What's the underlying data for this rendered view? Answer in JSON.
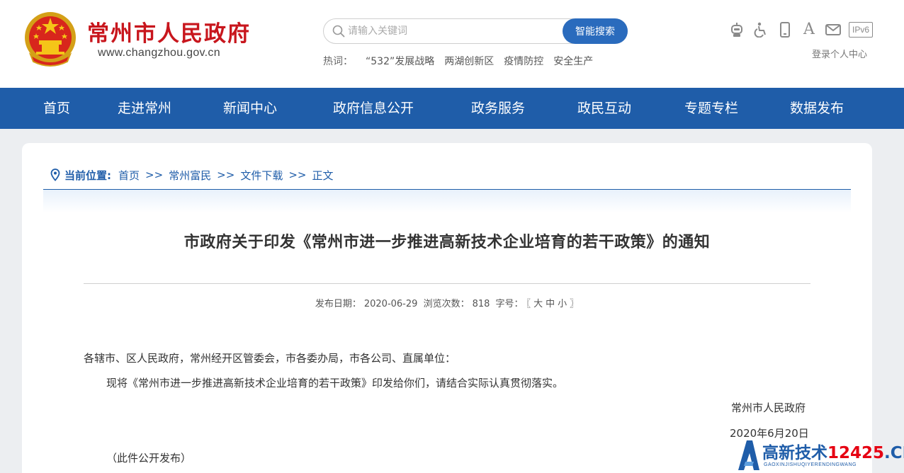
{
  "header": {
    "site_name": "常州市人民政府",
    "site_domain": "www.changzhou.gov.cn",
    "search": {
      "placeholder": "请输入关键词",
      "button_label": "智能搜索"
    },
    "hotwords": {
      "label": "热词：",
      "items": [
        "“532”发展战略",
        "两湖创新区",
        "疫情防控",
        "安全生产"
      ]
    },
    "tools": {
      "font_glyph": "A",
      "ipv6_label": "IPv6"
    },
    "login_label": "登录个人中心"
  },
  "nav": {
    "items": [
      "首页",
      "走进常州",
      "新闻中心",
      "政府信息公开",
      "政务服务",
      "政民互动",
      "专题专栏",
      "数据发布"
    ]
  },
  "breadcrumb": {
    "label": "当前位置:",
    "items": [
      "首页",
      "常州富民",
      "文件下载",
      "正文"
    ],
    "separator": ">>"
  },
  "article": {
    "title": "市政府关于印发《常州市进一步推进高新技术企业培育的若干政策》的通知",
    "meta": {
      "date_label": "发布日期：",
      "date": "2020-06-29",
      "views_label": "浏览次数：",
      "views": "818",
      "fontsize_label": "字号：",
      "bracket_open": "〖",
      "sizes": [
        "大",
        "中",
        "小"
      ],
      "bracket_close": "〗"
    },
    "salutation": "各辖市、区人民政府，常州经开区管委会，市各委办局，市各公司、直属单位：",
    "paragraph": "现将《常州市进一步推进高新技术企业培育的若干政策》印发给你们，请结合实际认真贯彻落实。",
    "signature": "常州市人民政府",
    "sign_date": "2020年6月20日",
    "note": "（此件公开发布）"
  },
  "watermark": {
    "text_main": "高新技术",
    "text_num": "12425",
    "text_cn": ".CN",
    "subtext": "GAOXINJISHUQIYERENDINGWANG"
  },
  "colors": {
    "brand_red": "#c8161d",
    "nav_blue": "#1f5da9",
    "search_blue": "#2a6bbd",
    "page_bg": "#eceef1"
  }
}
